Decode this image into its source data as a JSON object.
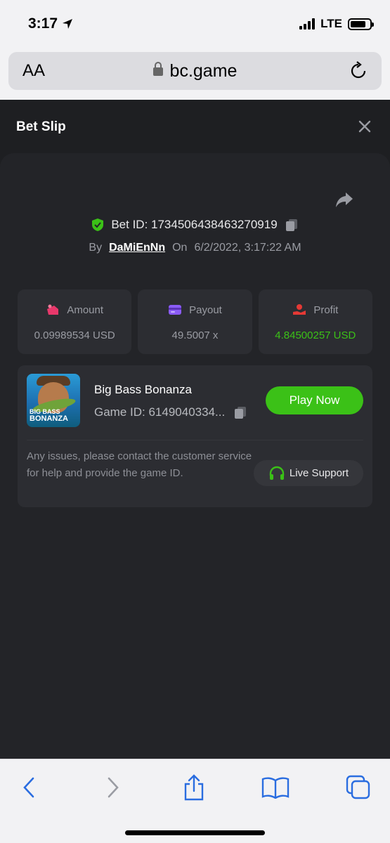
{
  "status_bar": {
    "time": "3:17",
    "network": "LTE"
  },
  "browser": {
    "text_size_label": "AA",
    "url": "bc.game"
  },
  "modal": {
    "title": "Bet Slip"
  },
  "bet": {
    "bet_id": "Bet ID: 1734506438463270919",
    "by_label": "By",
    "user": "DaMiEnNn",
    "on_label": "On",
    "date": "6/2/2022, 3:17:22 AM"
  },
  "stats": [
    {
      "label": "Amount",
      "value": "0.09989534 USD",
      "icon": "amount-icon",
      "color": "#e8386b"
    },
    {
      "label": "Payout",
      "value": "49.5007 x",
      "icon": "payout-card-icon",
      "color": "#8b5cf6"
    },
    {
      "label": "Profit",
      "value": "4.84500257 USD",
      "icon": "profit-hand-icon",
      "color": "#e53935"
    }
  ],
  "game": {
    "name": "Big Bass Bonanza",
    "game_id": "Game ID: 6149040334...",
    "thumb_line1": "BIG BASS",
    "thumb_line2": "BONANZA",
    "play_label": "Play Now",
    "issue_text": "Any issues, please contact the customer service for help and provide the game ID.",
    "support_label": "Live Support"
  },
  "colors": {
    "accent_green": "#3bc117",
    "panel": "#2c2d32",
    "background": "#1e1f22"
  }
}
